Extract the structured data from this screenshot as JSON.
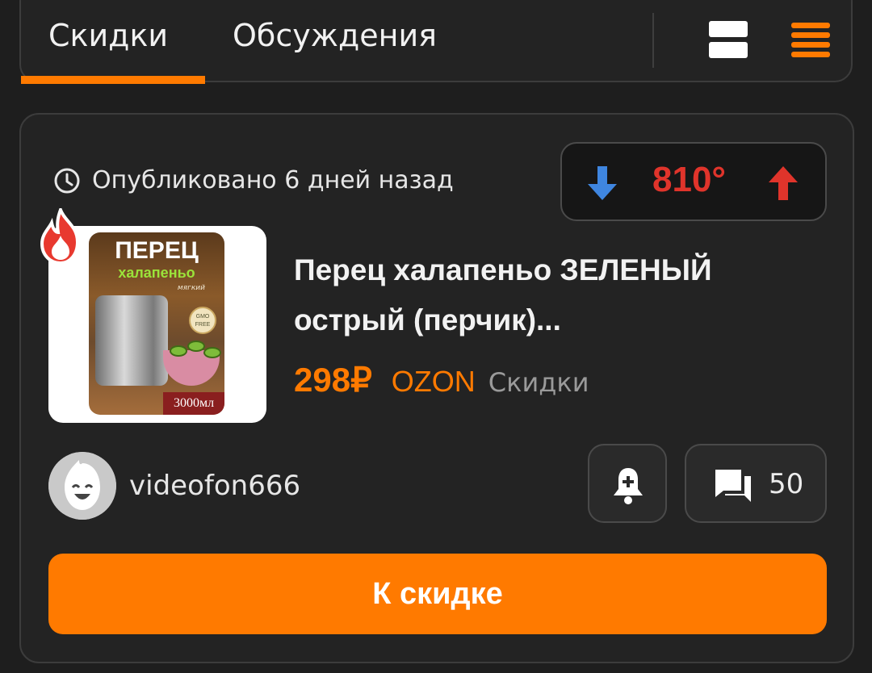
{
  "tabs": [
    {
      "label": "Скидки",
      "active": true
    },
    {
      "label": "Обсуждения",
      "active": false
    }
  ],
  "view_toggle": {
    "cards_icon": "view-cards-icon",
    "list_icon": "view-list-icon",
    "active_color": "#ff7a00"
  },
  "deal": {
    "published": "Опубликовано 6 дней назад",
    "temperature": "810°",
    "title": "Перец халапеньо ЗЕЛЕНЫЙ острый (перчик)...",
    "price": "298₽",
    "store": "OZON",
    "category": "Скидки",
    "image": {
      "title_line1": "ПЕРЕЦ",
      "title_line2": "халапеньо",
      "subtitle": "мягкий",
      "badge": "GMO FREE",
      "volume": "3000мл"
    },
    "author": "videofon666",
    "comments_count": "50",
    "cta_label": "К скидке"
  },
  "colors": {
    "accent": "#ff7a00",
    "vote_down": "#3f86e0",
    "vote_up": "#e0342b",
    "background": "#1e1e1e"
  }
}
